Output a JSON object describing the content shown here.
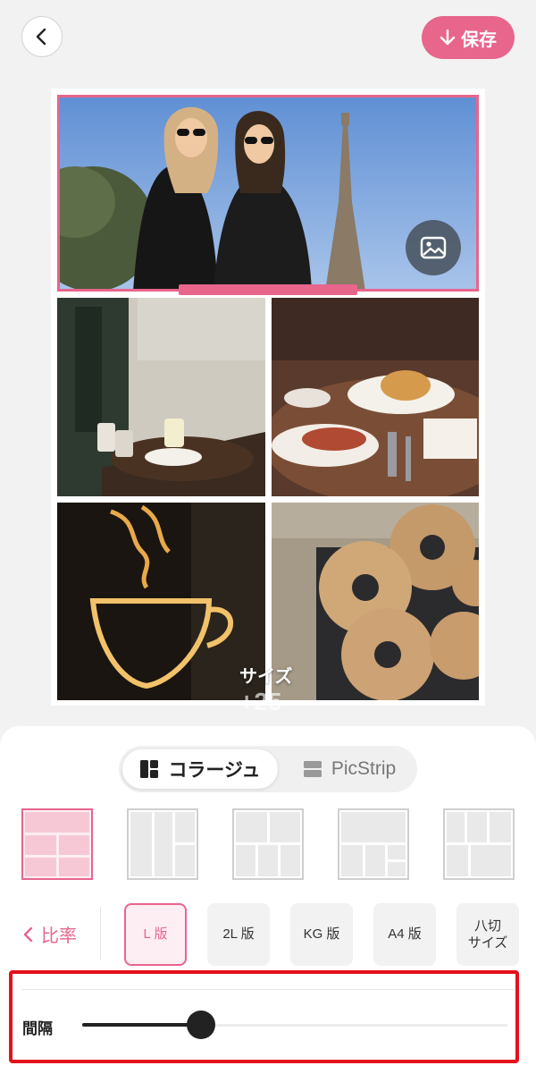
{
  "header": {
    "save_label": "保存"
  },
  "canvas_overlay": {
    "size_label": "サイズ",
    "size_value": "+25"
  },
  "mode_tabs": [
    {
      "label": "コラージュ",
      "active": true
    },
    {
      "label": "PicStrip",
      "active": false
    }
  ],
  "ratio": {
    "back_label": "比率"
  },
  "paper_sizes": [
    {
      "label": "L 版",
      "active": true
    },
    {
      "label": "2L 版",
      "active": false
    },
    {
      "label": "KG 版",
      "active": false
    },
    {
      "label": "A4 版",
      "active": false
    },
    {
      "label": "八切\nサイズ",
      "active": false
    }
  ],
  "spacing": {
    "label": "間隔",
    "value": 0.28
  },
  "colors": {
    "accent": "#e8658c",
    "highlight": "#e4101c"
  }
}
